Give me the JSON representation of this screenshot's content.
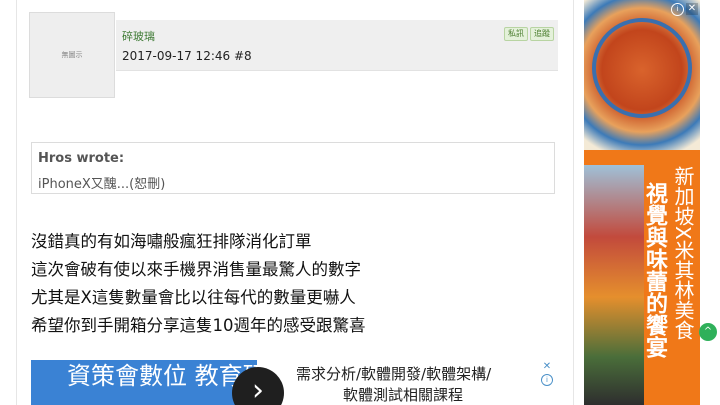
{
  "post": {
    "avatar_placeholder": "無圖示",
    "username": "碎玻璃",
    "timestamp": "2017-09-17 12:46  #8",
    "buttons": {
      "private_message": "私訊",
      "follow": "追蹤"
    },
    "quote": {
      "author": "Hros wrote:",
      "text": "iPhoneX又醜...(恕刪)"
    },
    "body_lines": [
      "沒錯真的有如海嘯般瘋狂排隊消化訂單",
      "這次會破有使以來手機界消售量最驚人的數字",
      "尤其是X這隻數量會比以往每代的數量更嚇人",
      "希望你到手開箱分享這隻10週年的感受跟驚喜"
    ]
  },
  "bottom_ad": {
    "brand_text": "資策會數位 教育研究所",
    "line1": "需求分析/軟體開發/軟體架構/",
    "line2": "軟體測試相關課程",
    "next_icon": "chevron-right-icon",
    "close_glyph": "✕",
    "info_glyph": "i"
  },
  "side_ad": {
    "headline": "視覺與味蕾的饗宴",
    "subheadline": "新加坡X米其林美食",
    "close_glyph": "✕",
    "info_glyph": "i",
    "accent_color": "#f07818"
  },
  "scroll_top": {
    "icon": "chevron-up-icon",
    "glyph": "^",
    "color": "#2fb05a"
  }
}
